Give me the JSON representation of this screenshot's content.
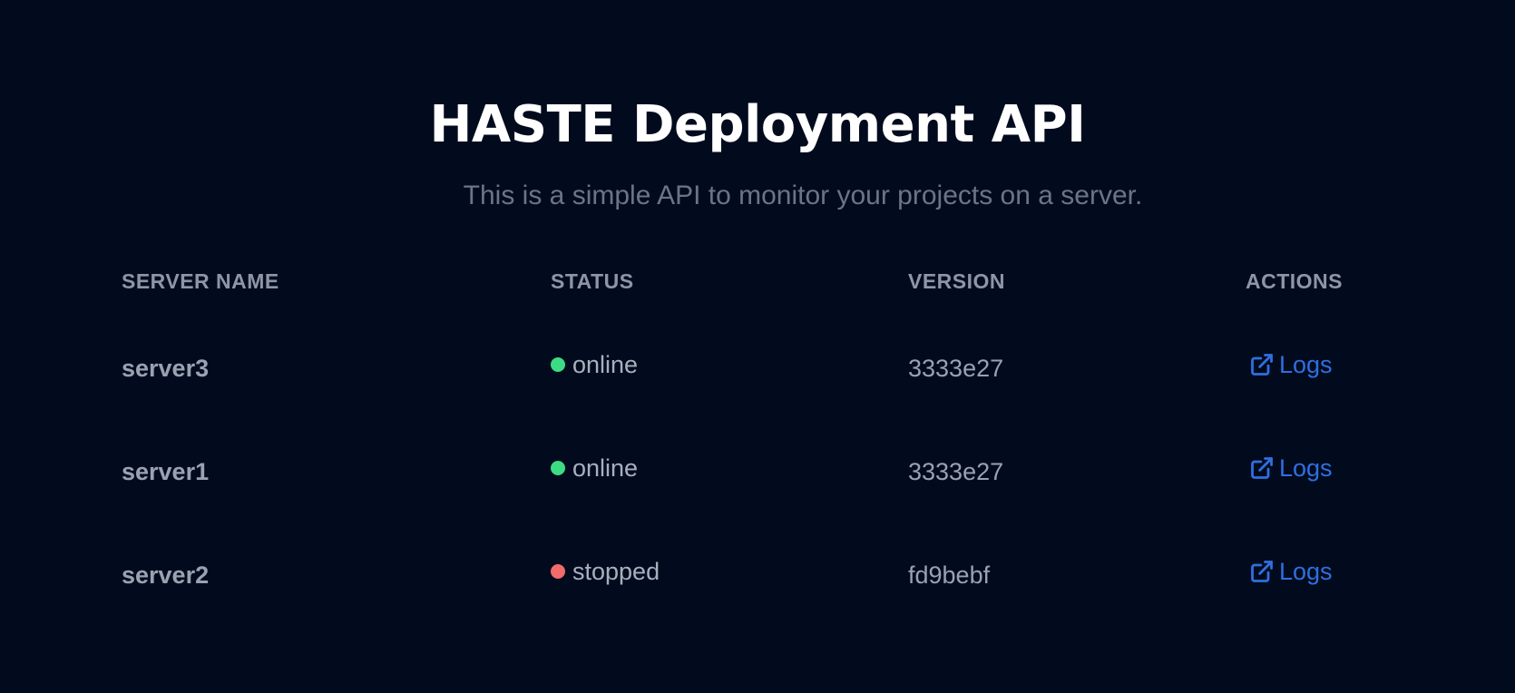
{
  "header": {
    "title": "HASTE Deployment API",
    "subtitle": "This is a simple API to monitor your projects on a server."
  },
  "table": {
    "columns": [
      "SERVER NAME",
      "STATUS",
      "VERSION",
      "ACTIONS"
    ],
    "rows": [
      {
        "name": "server3",
        "status": "online",
        "status_color": "#3ddc84",
        "version": "3333e27",
        "action": "Logs"
      },
      {
        "name": "server1",
        "status": "online",
        "status_color": "#3ddc84",
        "version": "3333e27",
        "action": "Logs"
      },
      {
        "name": "server2",
        "status": "stopped",
        "status_color": "#f26b6b",
        "version": "fd9bebf",
        "action": "Logs"
      }
    ]
  },
  "colors": {
    "background": "#020b1e",
    "link": "#2f6fe0",
    "online": "#3ddc84",
    "stopped": "#f26b6b"
  },
  "icons": {
    "action_icon": "external-link-icon"
  }
}
